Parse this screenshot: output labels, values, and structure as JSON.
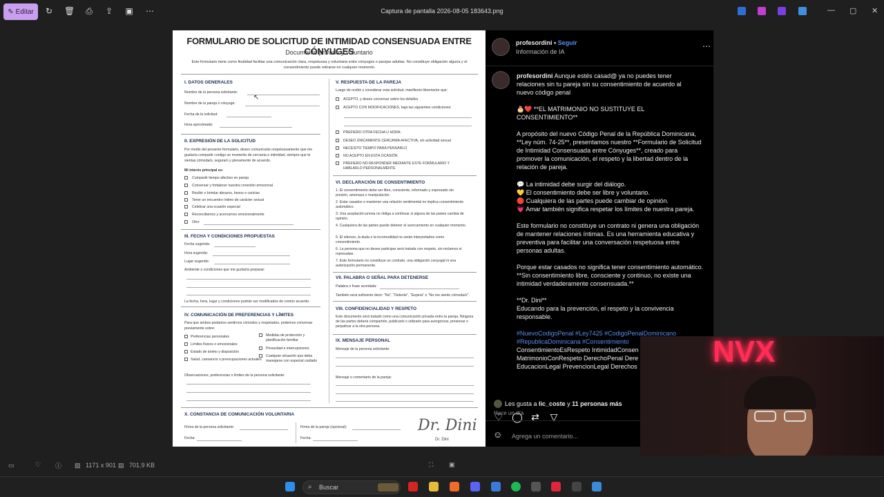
{
  "window": {
    "title": "Captura de pantalla 2026-08-05 183643.png",
    "edit_label": "Editar"
  },
  "document": {
    "title": "FORMULARIO DE SOLICITUD DE INTIMIDAD CONSENSUADA ENTRE CÓNYUGES",
    "subtitle": "Documento privado y voluntario",
    "intro": "Este formulario tiene como finalidad facilitar una comunicación clara, respetuosa y voluntaria entre cónyuges o parejas adultas. No constituye obligación alguna y el consentimiento puede retirarse en cualquier momento.",
    "s1": "I. DATOS GENERALES",
    "s1_fields": [
      "Nombre de la persona solicitante:",
      "Nombre de la pareja o cónyuge:",
      "Fecha de la solicitud:",
      "Hora aproximada:"
    ],
    "s2": "II. EXPRESIÓN DE LA SOLICITUD",
    "s2_text": "Por medio del presente formulario, deseo comunicarte respetuosamente que me gustaría compartir contigo un momento de cercanía e intimidad, siempre que te sientas cómoda/o, segura/o y plenamente de acuerdo.",
    "s2_interest": "Mi interés principal es:",
    "s2_items": [
      "Compartir tiempo afectivo en pareja",
      "Conversar y fortalecer nuestra conexión emocional",
      "Recibir o brindar abrazos, besos o caricias",
      "Tener un encuentro íntimo de carácter sexual",
      "Celebrar una ocasión especial",
      "Reconciliarnos y acercarnos emocionalmente",
      "Otro:"
    ],
    "s3": "III. FECHA Y CONDICIONES PROPUESTAS",
    "s3_fields": [
      "Fecha sugerida:",
      "Hora sugerida:",
      "Lugar sugerido:",
      "Ambiente o condiciones que me gustaría preparar:"
    ],
    "s3_note": "La fecha, hora, lugar y condiciones podrán ser modificados de común acuerdo.",
    "s4": "IV. COMUNICACIÓN DE PREFERENCIAS Y LÍMITES",
    "s4_text": "Para que ambos podamos sentirnos cómodos y respetados, podemos conversar previamente sobre:",
    "s4_items_left": [
      "Preferencias personales",
      "Límites físicos o emocionales",
      "Estado de ánimo y disposición",
      "Salud, cansancio o preocupaciones actuales"
    ],
    "s4_items_right": [
      "Medidas de protección y planificación familiar",
      "Privacidad e interrupciones",
      "Cualquier situación que deba manejarse con especial cuidado"
    ],
    "s4_obs": "Observaciones, preferencias o límites de la persona solicitante:",
    "s5": "V. RESPUESTA DE LA PAREJA",
    "s5_text": "Luego de recibir y considerar esta solicitud, manifiesto libremente que:",
    "s5_items": [
      "ACEPTO, y deseo conversar sobre los detalles",
      "ACEPTO CON MODIFICACIONES, bajo las siguientes condiciones:"
    ],
    "s5_items2": [
      "PREFIERO OTRA FECHA U HORA:",
      "DESEO ÚNICAMENTE CERCANÍA AFECTIVA, sin actividad sexual",
      "NECESITO TIEMPO PARA PENSARLO",
      "NO ACEPTO EN ESTA OCASIÓN",
      "PREFIERO NO RESPONDER MEDIANTE ESTE FORMULARIO Y HABLARLO PERSONALMENTE"
    ],
    "s6": "VI. DECLARACIÓN DE CONSENTIMIENTO",
    "s6_items": [
      "El consentimiento debe ser libre, consciente, informado y expresado sin presión, amenaza o manipulación.",
      "Estar casados o mantener una relación sentimental no implica consentimiento automático.",
      "Una aceptación previa no obliga a continuar si alguna de las partes cambia de opinión.",
      "Cualquiera de las partes puede detener el acercamiento en cualquier momento.",
      "El silencio, la duda o la incomodidad no serán interpretados como consentimiento.",
      "La persona que no desee participar será tratada con respeto, sin reclamos ni represalias.",
      "Este formulario no constituye un contrato, una obligación conyugal ni una autorización permanente."
    ],
    "s7": "VII. PALABRA O SEÑAL PARA DETENERSE",
    "s7_field": "Palabra o frase acordada:",
    "s7_note": "También será suficiente decir: \"No\", \"Detente\", \"Espera\" o \"No me siento cómoda/o\".",
    "s8": "VIII. CONFIDENCIALIDAD Y RESPETO",
    "s8_text": "Este documento será tratado como una comunicación privada entre la pareja. Ninguna de las partes deberá compartirlo, publicarlo o utilizarlo para avergonzar, presionar o perjudicar a la otra persona.",
    "s9": "IX. MENSAJE PERSONAL",
    "s9_f1": "Mensaje de la persona solicitante:",
    "s9_f2": "Mensaje o comentario de la pareja:",
    "sx": "X. CONSTANCIA DE COMUNICACIÓN VOLUNTARIA",
    "sx_f1": "Firma de la persona solicitante:",
    "sx_f2": "Firma de la pareja (opcional):",
    "sx_date": "Fecha:",
    "signature": "Dr. Dini",
    "signature_name": "Dr. Dini"
  },
  "post": {
    "username": "profesordini",
    "follow": "Seguir",
    "meta": "Información de IA",
    "caption_user": "profesordini",
    "caption_1": "Aunque estés casad@ ya no puedes tener relaciones sin tu pareja sin su consentimiento de acuerdo al nuevo código penal",
    "caption_2": "🎂❤️ **EL MATRIMONIO NO SUSTITUYE EL CONSENTIMIENTO**",
    "caption_3": "A propósito del nuevo Código Penal de la República Dominicana, **Ley núm. 74-25**, presentamos nuestro **Formulario de Solicitud de Intimidad Consensuada entre Cónyuges**, creado para promover la comunicación, el respeto y la libertad dentro de la relación de pareja.",
    "bullets": [
      "💬 La intimidad debe surgir del diálogo.",
      "💛 El consentimiento debe ser libre y voluntario.",
      "🔴 Cualquiera de las partes puede cambiar de opinión.",
      "💗 Amar también significa respetar los límites de nuestra pareja."
    ],
    "caption_4": "Este formulario no constituye un contrato ni genera una obligación de mantener relaciones íntimas. Es una herramienta educativa y preventiva para facilitar una conversación respetuosa entre personas adultas.",
    "caption_5": "Porque estar casados no significa tener consentimiento automático. **Sin consentimiento libre, consciente y continuo, no existe una intimidad verdaderamente consensuada.**",
    "caption_6": "**Dr. Dini**",
    "caption_7": "Educando para la prevención, el respeto y la convivencia responsable.",
    "hashtags": "#NuevoCodigoPenal #Ley7425 #CodigoPenalDominicano #RepublicaDominicana #Consentimiento",
    "tags_more": "ConsentimientoEsRespeto IntimidadConsen MatrimonioConRespeto DerechoPenal Dere EducacionLegal PrevencionLegal Derechos",
    "likes_pre": "Les gusta a ",
    "likes_user": "lic_coste",
    "likes_post": " y ",
    "likes_count": "11 personas más",
    "time": "Hace un día",
    "comment_placeholder": "Agrega un comentario..."
  },
  "status": {
    "dimensions": "1171 x 901",
    "size": "701.9 KB"
  },
  "taskbar": {
    "search": "Buscar"
  },
  "overlay": {
    "neon": "NVX"
  },
  "colors": {
    "accent": "#c9a0f0",
    "link": "#5a8dee",
    "doc_heading": "#1c2e50"
  }
}
